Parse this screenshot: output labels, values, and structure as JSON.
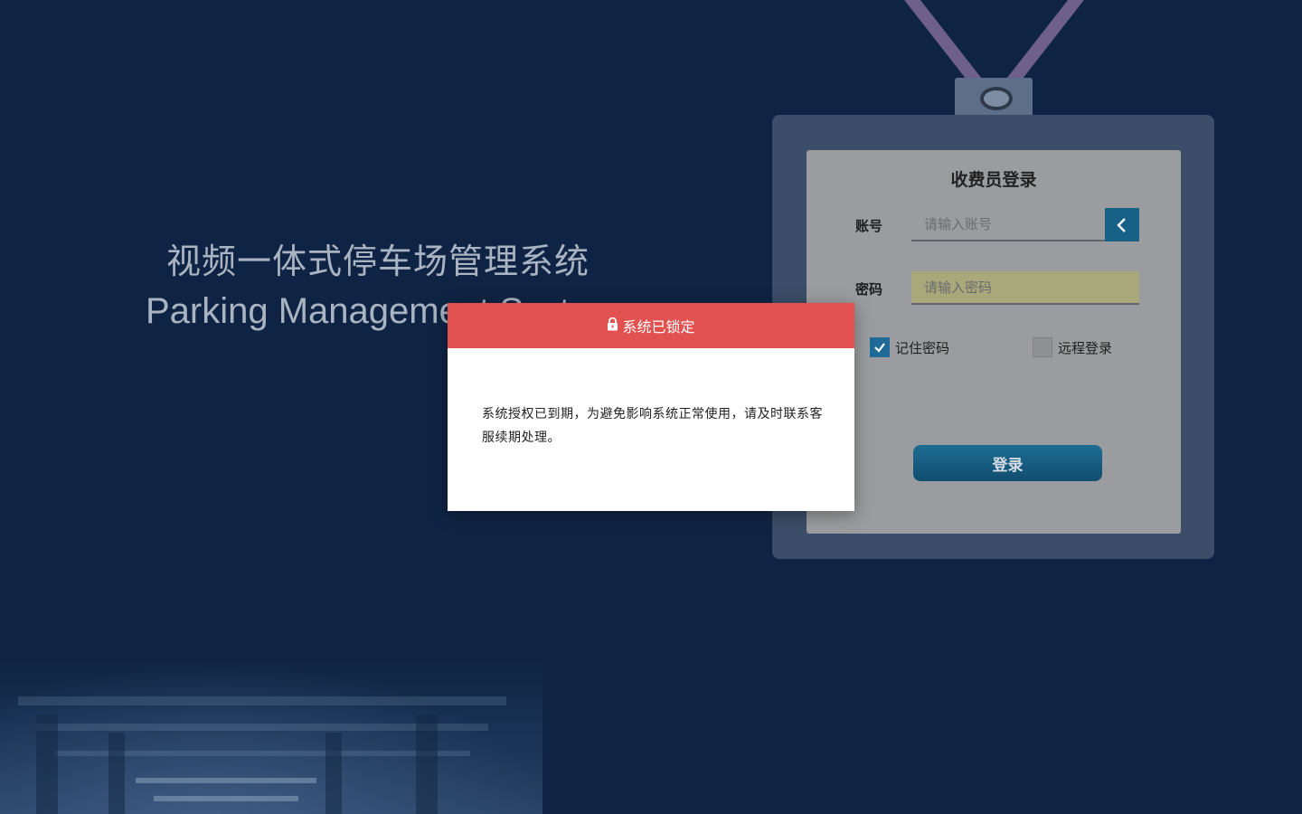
{
  "app": {
    "title_cn": "视频一体式停车场管理系统",
    "title_en": "Parking Management System"
  },
  "login": {
    "heading": "收费员登录",
    "account_label": "账号",
    "account_placeholder": "请输入账号",
    "account_value": "",
    "password_label": "密码",
    "password_placeholder": "请输入密码",
    "password_value": "",
    "remember_label": "记住密码",
    "remember_checked": true,
    "remote_label": "远程登录",
    "remote_checked": false,
    "submit_label": "登录",
    "back_icon": "chevron-left-icon"
  },
  "dialog": {
    "icon": "lock-icon",
    "title": "系统已锁定",
    "message": "系统授权已到期，为避免影响系统正常使用，请及时联系客服续期处理。",
    "header_color": "#e05150"
  },
  "colors": {
    "background": "#0f2444",
    "badge": "#3b4d68",
    "card": "#9a9c9f",
    "accent": "#176187"
  }
}
